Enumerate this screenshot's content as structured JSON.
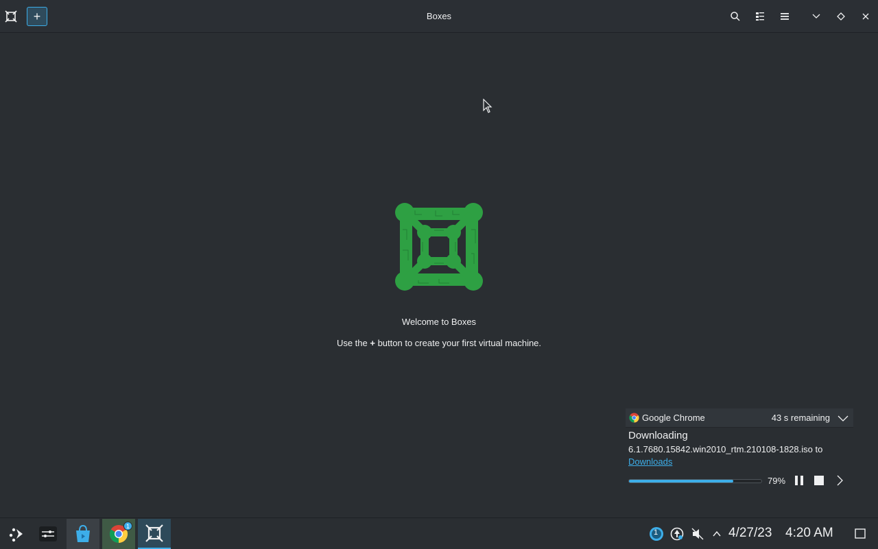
{
  "window": {
    "title": "Boxes",
    "add_label": "+"
  },
  "main": {
    "welcome": "Welcome to Boxes",
    "hint_before": "Use the ",
    "hint_plus": "+",
    "hint_after": " button to create your first virtual machine."
  },
  "notification": {
    "app_name": "Google Chrome",
    "remaining": "43 s remaining",
    "title": "Downloading",
    "file": "6.1.7680.15842.win2010_rtm.210108-1828.iso to",
    "destination_link": "Downloads",
    "progress": 0.79,
    "progress_label": "79%"
  },
  "taskbar": {
    "date": "4/27/23",
    "time": "4:20 AM",
    "chrome_badge": "1",
    "tray_badge": "1"
  },
  "colors": {
    "accent": "#3daee9",
    "logo_green": "#2ea043",
    "background": "#2a2e32"
  }
}
